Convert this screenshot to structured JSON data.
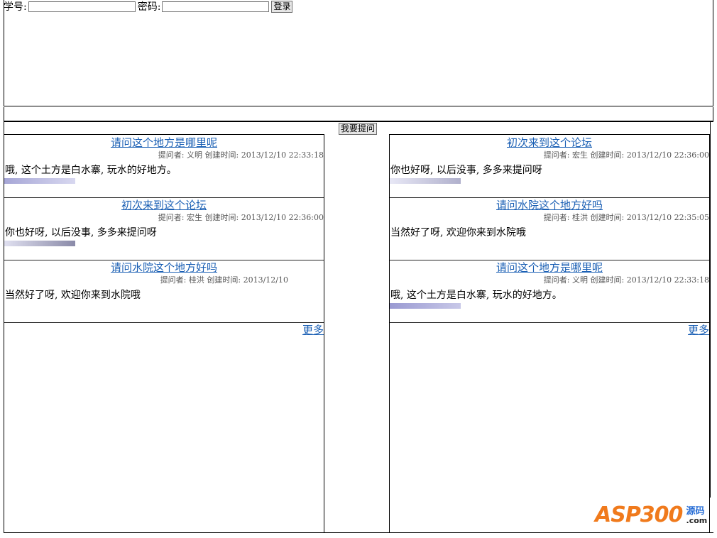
{
  "login": {
    "student_id_label": "学号:",
    "student_id_value": "",
    "password_label": "密码:",
    "password_value": "",
    "login_button": "登录"
  },
  "ask_button": "我要提问",
  "left_panel": {
    "posts": [
      {
        "title": "请问这个地方是哪里呢",
        "meta": "提问者: 义明 创建时间: 2013/12/10 22:33:18",
        "body": "哦, 这个土方是白水寨, 玩水的好地方。"
      },
      {
        "title": "初次来到这个论坛",
        "meta": "提问者: 宏生 创建时间: 2013/12/10 22:36:00",
        "body": "你也好呀, 以后没事, 多多来提问呀"
      },
      {
        "title": "请问水院这个地方好吗",
        "meta": "提问者: 桂洪 创建时间: 2013/12/10",
        "body": "当然好了呀, 欢迎你来到水院哦"
      }
    ],
    "more": "更多"
  },
  "right_panel": {
    "posts": [
      {
        "title": "初次来到这个论坛",
        "meta": "提问者: 宏生 创建时间: 2013/12/10 22:36:00",
        "body": "你也好呀, 以后没事, 多多来提问呀"
      },
      {
        "title": "请问水院这个地方好吗",
        "meta": "提问者: 桂洪 创建时间: 2013/12/10 22:35:05",
        "body": "当然好了呀, 欢迎你来到水院哦"
      },
      {
        "title": "请问这个地方是哪里呢",
        "meta": "提问者: 义明 创建时间: 2013/12/10 22:33:18",
        "body": "哦, 这个土方是白水寨, 玩水的好地方。"
      }
    ],
    "more": "更多"
  },
  "watermark": {
    "main": "ASP300",
    "sub": "源码",
    "domain": ".com"
  },
  "colors": {
    "link": "#1a5fb4",
    "meta": "#555555",
    "watermark": "#f07a1c"
  }
}
